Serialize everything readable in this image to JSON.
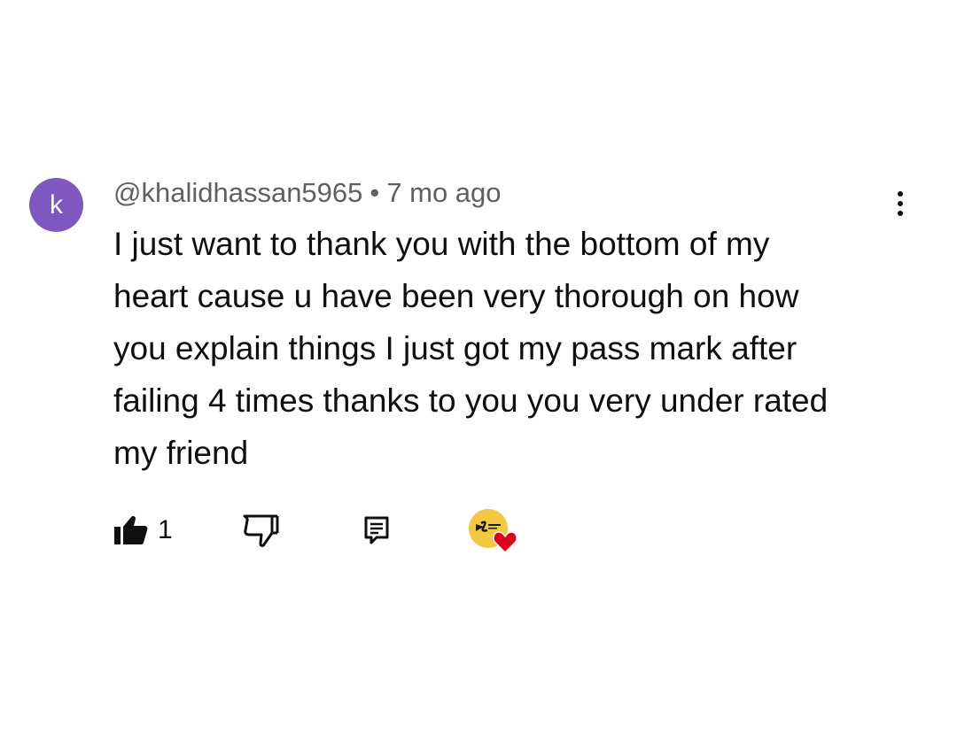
{
  "comment": {
    "avatar_letter": "k",
    "avatar_color": "#7e57c2",
    "author": "@khalidhassan5965",
    "separator": "•",
    "timestamp": "7 mo ago",
    "text_lines": [
      "I just want to thank you with the bottom of my",
      "heart cause u have been very thorough on how",
      "you explain things I just got my pass mark after",
      "failing 4 times thanks to you you very under rated",
      "my friend"
    ],
    "like_count": "1",
    "icons": {
      "more": "more-vertical-icon",
      "like": "thumbs-up-filled-icon",
      "dislike": "thumbs-down-icon",
      "reply": "reply-comment-icon",
      "creator_heart": "creator-heart-icon"
    },
    "heart_color": "#e0001b",
    "creator_avatar_color": "#f5c842"
  }
}
